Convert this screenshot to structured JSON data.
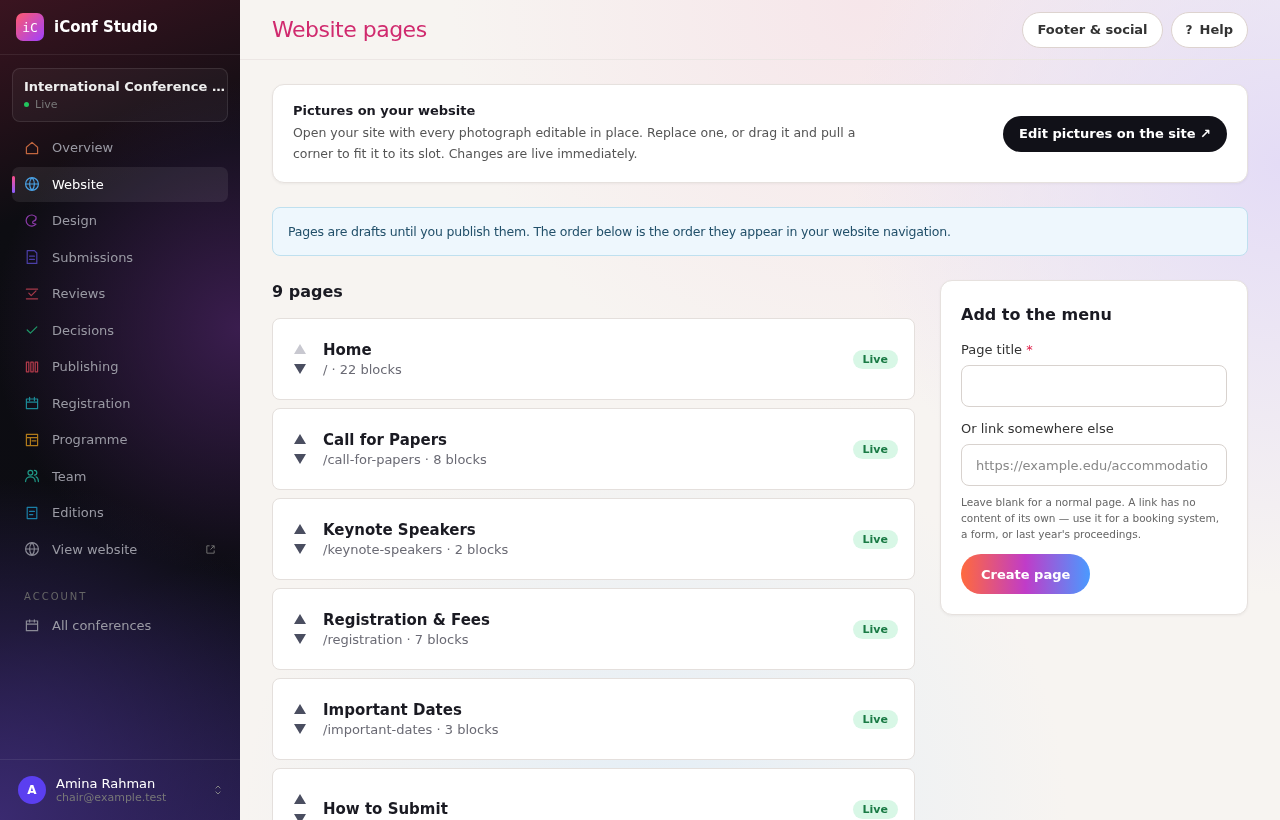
{
  "app": {
    "logo": "iC",
    "name": "iConf Studio"
  },
  "conference": {
    "name": "International Conference …",
    "status": "Live"
  },
  "nav": [
    {
      "label": "Overview",
      "selected": false
    },
    {
      "label": "Website",
      "selected": true
    },
    {
      "label": "Design",
      "selected": false
    },
    {
      "label": "Submissions",
      "selected": false
    },
    {
      "label": "Reviews",
      "selected": false
    },
    {
      "label": "Decisions",
      "selected": false
    },
    {
      "label": "Publishing",
      "selected": false
    },
    {
      "label": "Registration",
      "selected": false
    },
    {
      "label": "Programme",
      "selected": false
    },
    {
      "label": "Team",
      "selected": false
    },
    {
      "label": "Editions",
      "selected": false
    },
    {
      "label": "View website",
      "selected": false,
      "external": true
    }
  ],
  "account": {
    "heading": "ACCOUNT",
    "items": [
      {
        "label": "All conferences",
        "selected": false
      }
    ]
  },
  "user": {
    "initial": "A",
    "name": "Amina Rahman",
    "email": "chair@example.test"
  },
  "header": {
    "title": "Website pages",
    "buttons": [
      {
        "label": "Footer & social"
      },
      {
        "icon": "?",
        "label": "Help"
      }
    ]
  },
  "pictures_card": {
    "title": "Pictures on your website",
    "text": "Open your site with every photograph editable in place. Replace one, or drag it and pull a corner to fit it to its slot. Changes are live immediately.",
    "button": "Edit pictures on the site",
    "button_icon": "↗"
  },
  "notice": "Pages are drafts until you publish them. The order below is the order they appear in your website navigation.",
  "pages_heading": "9 pages",
  "pages": [
    {
      "title": "Home",
      "path": "/ · 22 blocks",
      "status": "Live",
      "up_disabled": true
    },
    {
      "title": "Call for Papers",
      "path": "/call-for-papers · 8 blocks",
      "status": "Live",
      "up_disabled": false
    },
    {
      "title": "Keynote Speakers",
      "path": "/keynote-speakers · 2 blocks",
      "status": "Live",
      "up_disabled": false
    },
    {
      "title": "Registration & Fees",
      "path": "/registration · 7 blocks",
      "status": "Live",
      "up_disabled": false
    },
    {
      "title": "Important Dates",
      "path": "/important-dates · 3 blocks",
      "status": "Live",
      "up_disabled": false
    },
    {
      "title": "How to Submit",
      "status": "Live",
      "up_disabled": false
    }
  ],
  "add_form": {
    "title": "Add to the menu",
    "title_label": "Page title",
    "required_mark": "*",
    "link_label": "Or link somewhere else",
    "link_placeholder": "https://example.edu/accommodatio",
    "hint": "Leave blank for a normal page. A link has no content of its own — use it for a booking system, a form, or last year's proceedings.",
    "button": "Create page"
  }
}
